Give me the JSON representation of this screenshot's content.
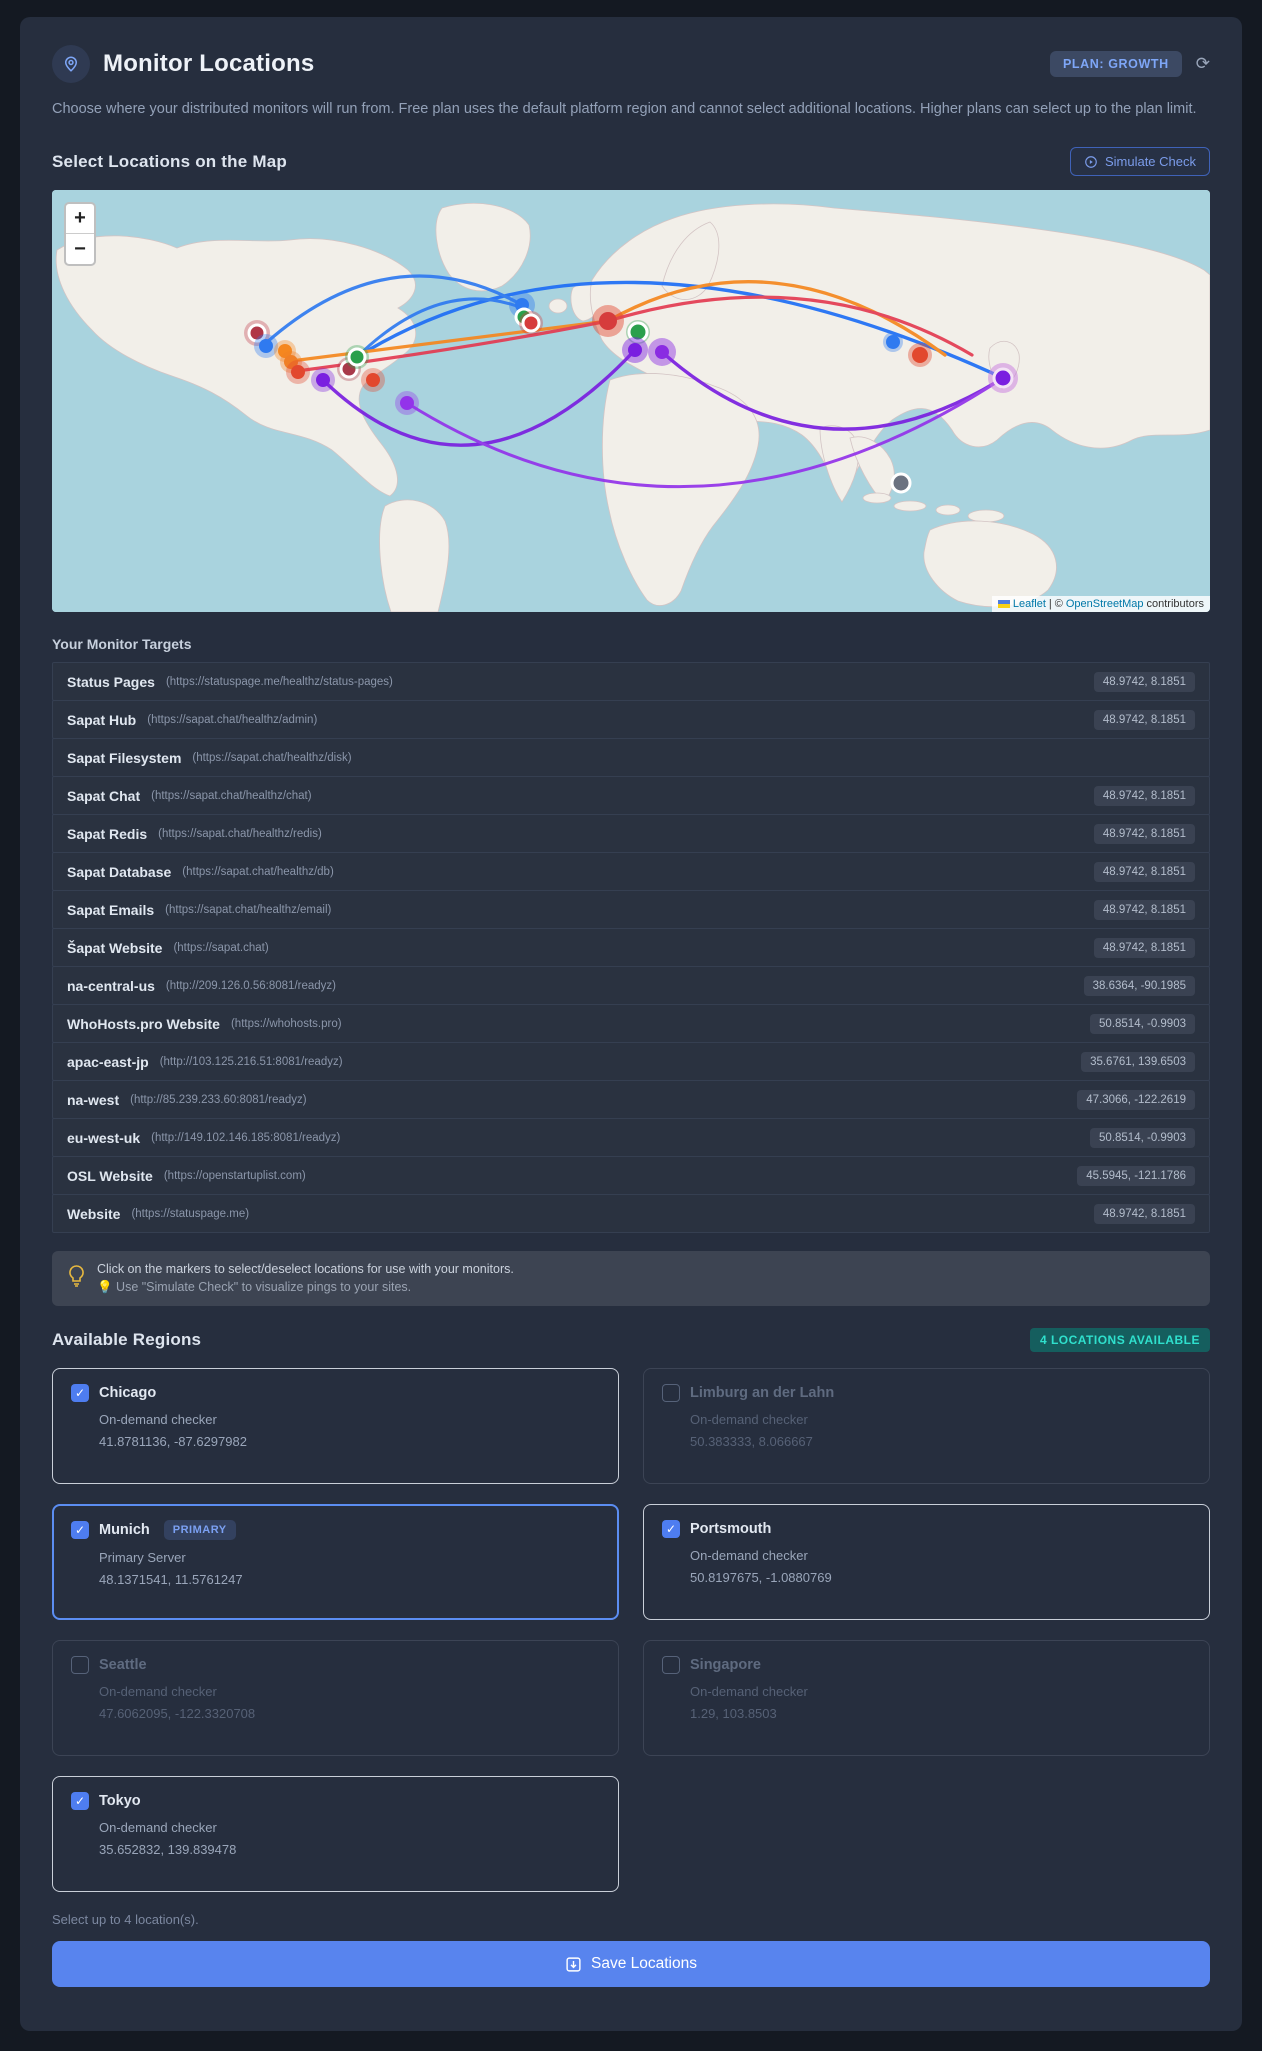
{
  "header": {
    "title": "Monitor Locations",
    "plan_badge": "PLAN: GROWTH",
    "refresh_icon": "refresh-icon",
    "description": "Choose where your distributed monitors will run from. Free plan uses the default platform region and cannot select additional locations. Higher plans can select up to the plan limit."
  },
  "map_section": {
    "heading": "Select Locations on the Map",
    "simulate_button": "Simulate Check",
    "zoom_in": "+",
    "zoom_out": "−",
    "attribution": {
      "leaflet": "Leaflet",
      "separator": "|",
      "copyright": "©",
      "osm": "OpenStreetMap",
      "contributors": "contributors"
    }
  },
  "targets": {
    "heading": "Your Monitor Targets",
    "items": [
      {
        "name": "Status Pages",
        "url": "(https://statuspage.me/healthz/status-pages)",
        "coords": "48.9742, 8.1851"
      },
      {
        "name": "Sapat Hub",
        "url": "(https://sapat.chat/healthz/admin)",
        "coords": "48.9742, 8.1851"
      },
      {
        "name": "Sapat Filesystem",
        "url": "(https://sapat.chat/healthz/disk)",
        "coords": ""
      },
      {
        "name": "Sapat Chat",
        "url": "(https://sapat.chat/healthz/chat)",
        "coords": "48.9742, 8.1851"
      },
      {
        "name": "Sapat Redis",
        "url": "(https://sapat.chat/healthz/redis)",
        "coords": "48.9742, 8.1851"
      },
      {
        "name": "Sapat Database",
        "url": "(https://sapat.chat/healthz/db)",
        "coords": "48.9742, 8.1851"
      },
      {
        "name": "Sapat Emails",
        "url": "(https://sapat.chat/healthz/email)",
        "coords": "48.9742, 8.1851"
      },
      {
        "name": "Šapat Website",
        "url": "(https://sapat.chat)",
        "coords": "48.9742, 8.1851"
      },
      {
        "name": "na-central-us",
        "url": "(http://209.126.0.56:8081/readyz)",
        "coords": "38.6364, -90.1985"
      },
      {
        "name": "WhoHosts.pro Website",
        "url": "(https://whohosts.pro)",
        "coords": "50.8514, -0.9903"
      },
      {
        "name": "apac-east-jp",
        "url": "(http://103.125.216.51:8081/readyz)",
        "coords": "35.6761, 139.6503"
      },
      {
        "name": "na-west",
        "url": "(http://85.239.233.60:8081/readyz)",
        "coords": "47.3066, -122.2619"
      },
      {
        "name": "eu-west-uk",
        "url": "(http://149.102.146.185:8081/readyz)",
        "coords": "50.8514, -0.9903"
      },
      {
        "name": "OSL Website",
        "url": "(https://openstartuplist.com)",
        "coords": "45.5945, -121.1786"
      },
      {
        "name": "Website",
        "url": "(https://statuspage.me)",
        "coords": "48.9742, 8.1851"
      }
    ]
  },
  "tip": {
    "line1": "Click on the markers to select/deselect locations for use with your monitors.",
    "line2": "💡 Use \"Simulate Check\" to visualize pings to your sites."
  },
  "regions": {
    "heading": "Available Regions",
    "badge": "4 LOCATIONS AVAILABLE",
    "note": "Select up to 4 location(s).",
    "cards": [
      {
        "name": "Chicago",
        "subtitle": "On-demand checker",
        "coords": "41.8781136, -87.6297982",
        "checked": true
      },
      {
        "name": "Limburg an der Lahn",
        "subtitle": "On-demand checker",
        "coords": "50.383333, 8.066667",
        "checked": false
      },
      {
        "name": "Munich",
        "badge": "PRIMARY",
        "subtitle": "Primary Server",
        "coords": "48.1371541, 11.5761247",
        "checked": true
      },
      {
        "name": "Portsmouth",
        "subtitle": "On-demand checker",
        "coords": "50.8197675, -1.0880769",
        "checked": true
      },
      {
        "name": "Seattle",
        "subtitle": "On-demand checker",
        "coords": "47.6062095, -122.3320708",
        "checked": false
      },
      {
        "name": "Singapore",
        "subtitle": "On-demand checker",
        "coords": "1.29, 103.8503",
        "checked": false
      },
      {
        "name": "Tokyo",
        "subtitle": "On-demand checker",
        "coords": "35.652832, 139.839478",
        "checked": true
      }
    ]
  },
  "save_button": "Save Locations",
  "colors": {
    "accent_blue": "#5884ee",
    "badge_teal_text": "#2fe0cd",
    "map_water": "#a9d3de",
    "map_land": "#f2efe9",
    "arc_blue": "#1e6ef5",
    "arc_orange": "#f5871f",
    "arc_crimson": "#e33b52",
    "arc_violet": "#7a1fe0"
  }
}
